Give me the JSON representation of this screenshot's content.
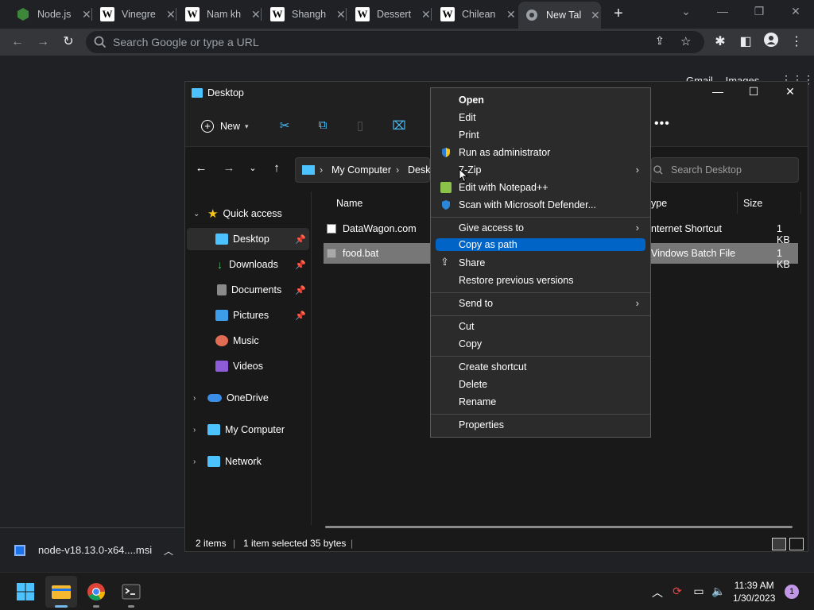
{
  "browser": {
    "tabs": [
      {
        "title": "Node.js",
        "icon": "nodejs-icon"
      },
      {
        "title": "Vinegre",
        "icon": "wikipedia-icon"
      },
      {
        "title": "Nam kh",
        "icon": "wikipedia-icon"
      },
      {
        "title": "Shangh",
        "icon": "wikipedia-icon"
      },
      {
        "title": "Dessert",
        "icon": "wikipedia-icon"
      },
      {
        "title": "Chilean",
        "icon": "wikipedia-icon"
      },
      {
        "title": "New Tal",
        "icon": "chrome-icon",
        "active": true
      }
    ],
    "omnibox_placeholder": "Search Google or type a URL",
    "google_links": [
      "Gmail",
      "Images"
    ]
  },
  "download": {
    "filename": "node-v18.13.0-x64....msi"
  },
  "explorer": {
    "title": "Desktop",
    "new_label": "New",
    "breadcrumb": [
      "My Computer",
      "Deskt"
    ],
    "search_placeholder": "Search Desktop",
    "sidebar": [
      {
        "label": "Quick access",
        "icon": "star-icon",
        "level": 0,
        "chevron": "down"
      },
      {
        "label": "Desktop",
        "icon": "desktop-icon",
        "level": 1,
        "pinned": true,
        "selected": true
      },
      {
        "label": "Downloads",
        "icon": "download-icon",
        "level": 1,
        "pinned": true
      },
      {
        "label": "Documents",
        "icon": "documents-icon",
        "level": 1,
        "pinned": true
      },
      {
        "label": "Pictures",
        "icon": "pictures-icon",
        "level": 1,
        "pinned": true
      },
      {
        "label": "Music",
        "icon": "music-icon",
        "level": 1
      },
      {
        "label": "Videos",
        "icon": "videos-icon",
        "level": 1
      },
      {
        "label": "OneDrive",
        "icon": "onedrive-icon",
        "level": 0,
        "chevron": "right"
      },
      {
        "label": "My Computer",
        "icon": "computer-icon",
        "level": 0,
        "chevron": "right"
      },
      {
        "label": "Network",
        "icon": "network-icon",
        "level": 0,
        "chevron": "right"
      }
    ],
    "columns": {
      "name": "Name",
      "type": "ype",
      "size": "Size"
    },
    "files": [
      {
        "name": "DataWagon.com",
        "type": "nternet Shortcut",
        "size": "1 KB",
        "selected": false
      },
      {
        "name": "food.bat",
        "type": "Vindows Batch File",
        "size": "1 KB",
        "selected": true
      }
    ],
    "status": {
      "items": "2 items",
      "selected": "1 item selected  35 bytes"
    }
  },
  "context_menu": {
    "items": [
      {
        "label": "Open",
        "bold": true
      },
      {
        "label": "Edit"
      },
      {
        "label": "Print"
      },
      {
        "label": "Run as administrator",
        "icon": "shield-icon"
      },
      {
        "label": "7-Zip",
        "submenu": true
      },
      {
        "label": "Edit with Notepad++",
        "icon": "notepadpp-icon"
      },
      {
        "label": "Scan with Microsoft Defender...",
        "icon": "defender-icon"
      },
      {
        "separator": true
      },
      {
        "label": "Give access to",
        "submenu": true
      },
      {
        "label": "Copy as path",
        "highlighted": true
      },
      {
        "label": "Share",
        "icon": "share-icon"
      },
      {
        "label": "Restore previous versions"
      },
      {
        "separator": true
      },
      {
        "label": "Send to",
        "submenu": true
      },
      {
        "separator": true
      },
      {
        "label": "Cut"
      },
      {
        "label": "Copy"
      },
      {
        "separator": true
      },
      {
        "label": "Create shortcut"
      },
      {
        "label": "Delete"
      },
      {
        "label": "Rename"
      },
      {
        "separator": true
      },
      {
        "label": "Properties"
      }
    ]
  },
  "taskbar": {
    "time": "11:39 AM",
    "date": "1/30/2023",
    "notifications": "1"
  },
  "colors": {
    "accent": "#0063c6",
    "explorer_bg": "#191919",
    "chrome_bg": "#202124"
  }
}
